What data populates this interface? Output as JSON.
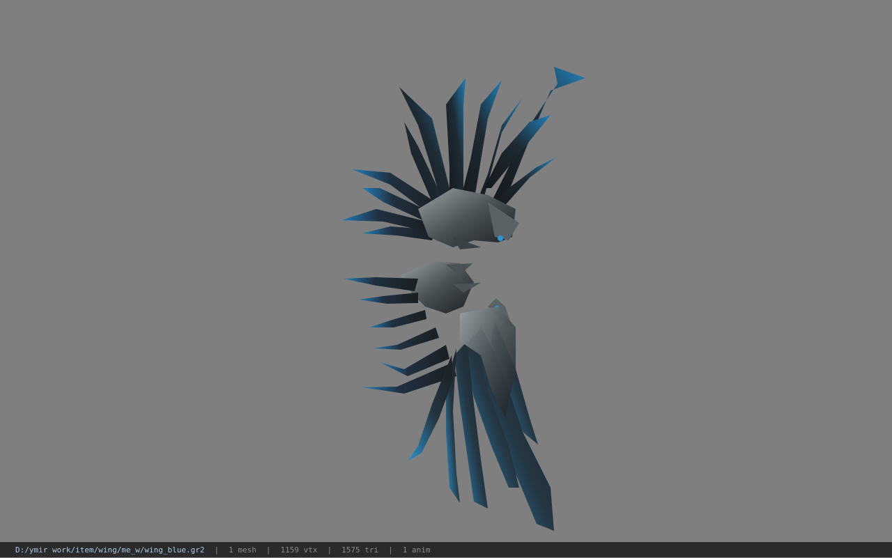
{
  "viewer": {
    "background_color": "#7f7f7f",
    "model": {
      "name": "wing-model",
      "colors": {
        "dark": "#1a1e22",
        "mid": "#2c3a44",
        "accent_blue": "#1f7fb8",
        "bright_blue": "#2a95d0",
        "metal": "#8a9296"
      }
    }
  },
  "statusbar": {
    "file_path": "D:/ymir work/item/wing/me_w/wing_blue.gr2",
    "mesh_count": "1 mesh",
    "vertex_count": "1159 vtx",
    "triangle_count": "1575 tri",
    "anim_count": "1 anim",
    "separator": "|"
  }
}
